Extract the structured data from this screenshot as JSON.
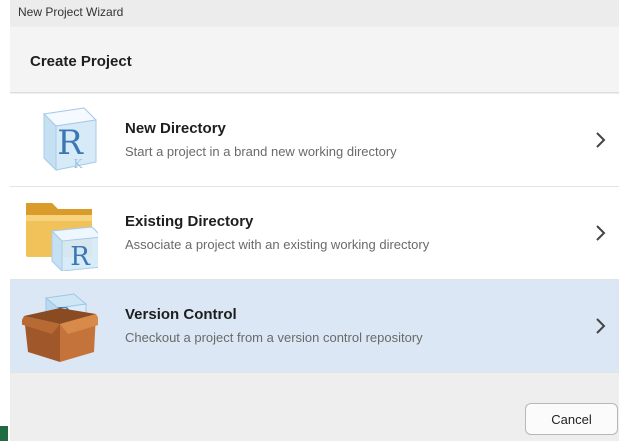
{
  "window": {
    "title": "New Project Wizard"
  },
  "header": {
    "title": "Create Project"
  },
  "options": [
    {
      "title": "New Directory",
      "description": "Start a project in a brand new working directory",
      "icon": "r-cube-icon",
      "selected": false
    },
    {
      "title": "Existing Directory",
      "description": "Associate a project with an existing working directory",
      "icon": "folder-r-icon",
      "selected": false
    },
    {
      "title": "Version Control",
      "description": "Checkout a project from a version control repository",
      "icon": "package-box-icon",
      "selected": true
    }
  ],
  "footer": {
    "cancel_label": "Cancel"
  },
  "colors": {
    "selected_bg": "#dbe7f4",
    "accent_green": "#1f6b44"
  }
}
